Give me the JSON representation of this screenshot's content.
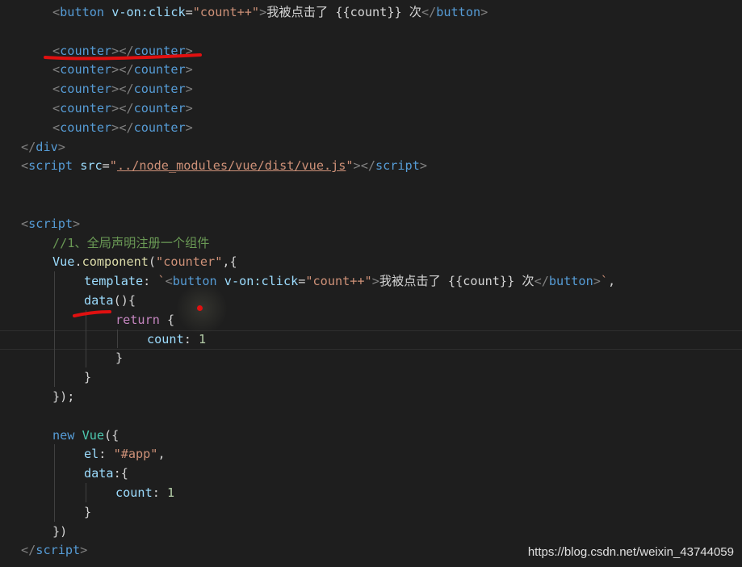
{
  "editor": {
    "lines": [
      {
        "id": "l1",
        "indent": 1,
        "tokens": [
          [
            "p",
            "<"
          ],
          [
            "t",
            "button"
          ],
          [
            "w",
            " "
          ],
          [
            "a",
            "v-on:click"
          ],
          [
            "w",
            "="
          ],
          [
            "s",
            "\"count++\""
          ],
          [
            "p",
            ">"
          ],
          [
            "w",
            "我被点击了 {{count}} 次"
          ],
          [
            "p",
            "</"
          ],
          [
            "t",
            "button"
          ],
          [
            "p",
            ">"
          ]
        ]
      },
      {
        "id": "l2",
        "indent": 1,
        "tokens": []
      },
      {
        "id": "l3",
        "indent": 1,
        "tokens": [
          [
            "p",
            "<"
          ],
          [
            "t",
            "counter"
          ],
          [
            "p",
            "></"
          ],
          [
            "t",
            "counter"
          ],
          [
            "p",
            ">"
          ]
        ]
      },
      {
        "id": "l4",
        "indent": 1,
        "tokens": [
          [
            "p",
            "<"
          ],
          [
            "t",
            "counter"
          ],
          [
            "p",
            "></"
          ],
          [
            "t",
            "counter"
          ],
          [
            "p",
            ">"
          ]
        ]
      },
      {
        "id": "l5",
        "indent": 1,
        "tokens": [
          [
            "p",
            "<"
          ],
          [
            "t",
            "counter"
          ],
          [
            "p",
            "></"
          ],
          [
            "t",
            "counter"
          ],
          [
            "p",
            ">"
          ]
        ]
      },
      {
        "id": "l6",
        "indent": 1,
        "tokens": [
          [
            "p",
            "<"
          ],
          [
            "t",
            "counter"
          ],
          [
            "p",
            "></"
          ],
          [
            "t",
            "counter"
          ],
          [
            "p",
            ">"
          ]
        ]
      },
      {
        "id": "l7",
        "indent": 1,
        "tokens": [
          [
            "p",
            "<"
          ],
          [
            "t",
            "counter"
          ],
          [
            "p",
            "></"
          ],
          [
            "t",
            "counter"
          ],
          [
            "p",
            ">"
          ]
        ]
      },
      {
        "id": "l8",
        "indent": 0,
        "tokens": [
          [
            "p",
            "</"
          ],
          [
            "t",
            "div"
          ],
          [
            "p",
            ">"
          ]
        ]
      },
      {
        "id": "l9",
        "indent": 0,
        "tokens": [
          [
            "p",
            "<"
          ],
          [
            "t",
            "script"
          ],
          [
            "w",
            " "
          ],
          [
            "a",
            "src"
          ],
          [
            "w",
            "="
          ],
          [
            "s",
            "\""
          ],
          [
            "su",
            "../node_modules/vue/dist/vue.js"
          ],
          [
            "s",
            "\""
          ],
          [
            "p",
            "></"
          ],
          [
            "t",
            "script"
          ],
          [
            "p",
            ">"
          ]
        ]
      },
      {
        "id": "l10",
        "indent": 0,
        "tokens": []
      },
      {
        "id": "l11",
        "indent": 0,
        "tokens": []
      },
      {
        "id": "l12",
        "indent": 0,
        "tokens": [
          [
            "p",
            "<"
          ],
          [
            "t",
            "script"
          ],
          [
            "p",
            ">"
          ]
        ]
      },
      {
        "id": "l13",
        "indent": 1,
        "tokens": [
          [
            "c",
            "//1、全局声明注册一个组件"
          ]
        ]
      },
      {
        "id": "l14",
        "indent": 1,
        "tokens": [
          [
            "a",
            "Vue"
          ],
          [
            "w",
            "."
          ],
          [
            "fn",
            "component"
          ],
          [
            "w",
            "("
          ],
          [
            "s",
            "\"counter\""
          ],
          [
            "w",
            ",{"
          ]
        ]
      },
      {
        "id": "l15",
        "indent": 2,
        "tokens": [
          [
            "a",
            "template"
          ],
          [
            "w",
            ": "
          ],
          [
            "s",
            "`"
          ],
          [
            "p",
            "<"
          ],
          [
            "t",
            "button"
          ],
          [
            "w",
            " "
          ],
          [
            "a",
            "v-on:click"
          ],
          [
            "w",
            "="
          ],
          [
            "s",
            "\"count++\""
          ],
          [
            "p",
            ">"
          ],
          [
            "w",
            "我被点击了 {{count}} 次"
          ],
          [
            "p",
            "</"
          ],
          [
            "t",
            "button"
          ],
          [
            "p",
            ">"
          ],
          [
            "s",
            "`"
          ],
          [
            "w",
            ","
          ]
        ]
      },
      {
        "id": "l16",
        "indent": 2,
        "tokens": [
          [
            "a",
            "data"
          ],
          [
            "w",
            "(){"
          ]
        ]
      },
      {
        "id": "l17",
        "indent": 3,
        "tokens": [
          [
            "k",
            "return"
          ],
          [
            "w",
            " {"
          ]
        ]
      },
      {
        "id": "l18",
        "indent": 4,
        "tokens": [
          [
            "a",
            "count"
          ],
          [
            "w",
            ": "
          ],
          [
            "n",
            "1"
          ]
        ]
      },
      {
        "id": "l19",
        "indent": 3,
        "tokens": [
          [
            "w",
            "}"
          ]
        ]
      },
      {
        "id": "l20",
        "indent": 2,
        "tokens": [
          [
            "w",
            "}"
          ]
        ]
      },
      {
        "id": "l21",
        "indent": 1,
        "tokens": [
          [
            "w",
            "});"
          ]
        ]
      },
      {
        "id": "l22",
        "indent": 1,
        "tokens": []
      },
      {
        "id": "l23",
        "indent": 1,
        "tokens": [
          [
            "t",
            "new"
          ],
          [
            "w",
            " "
          ],
          [
            "cls",
            "Vue"
          ],
          [
            "w",
            "({"
          ]
        ]
      },
      {
        "id": "l24",
        "indent": 2,
        "tokens": [
          [
            "a",
            "el"
          ],
          [
            "w",
            ": "
          ],
          [
            "s",
            "\"#app\""
          ],
          [
            "w",
            ","
          ]
        ]
      },
      {
        "id": "l25",
        "indent": 2,
        "tokens": [
          [
            "a",
            "data"
          ],
          [
            "w",
            ":{"
          ]
        ]
      },
      {
        "id": "l26",
        "indent": 3,
        "tokens": [
          [
            "a",
            "count"
          ],
          [
            "w",
            ": "
          ],
          [
            "n",
            "1"
          ]
        ]
      },
      {
        "id": "l27",
        "indent": 2,
        "tokens": [
          [
            "w",
            "}"
          ]
        ]
      },
      {
        "id": "l28",
        "indent": 1,
        "tokens": [
          [
            "w",
            "})"
          ]
        ]
      },
      {
        "id": "l29",
        "indent": 0,
        "tokens": [
          [
            "p",
            "</"
          ],
          [
            "t",
            "script"
          ],
          [
            "p",
            ">"
          ]
        ]
      }
    ]
  },
  "watermark": "https://blog.csdn.net/weixin_43744059",
  "colors": {
    "background": "#1e1e1e",
    "tag": "#569cd6",
    "attribute": "#9cdcfe",
    "string": "#ce9178",
    "comment": "#6a9955",
    "keyword": "#c586c0",
    "function": "#dcdcaa",
    "number": "#b5cea8",
    "annotation_marker": "#e01010"
  }
}
